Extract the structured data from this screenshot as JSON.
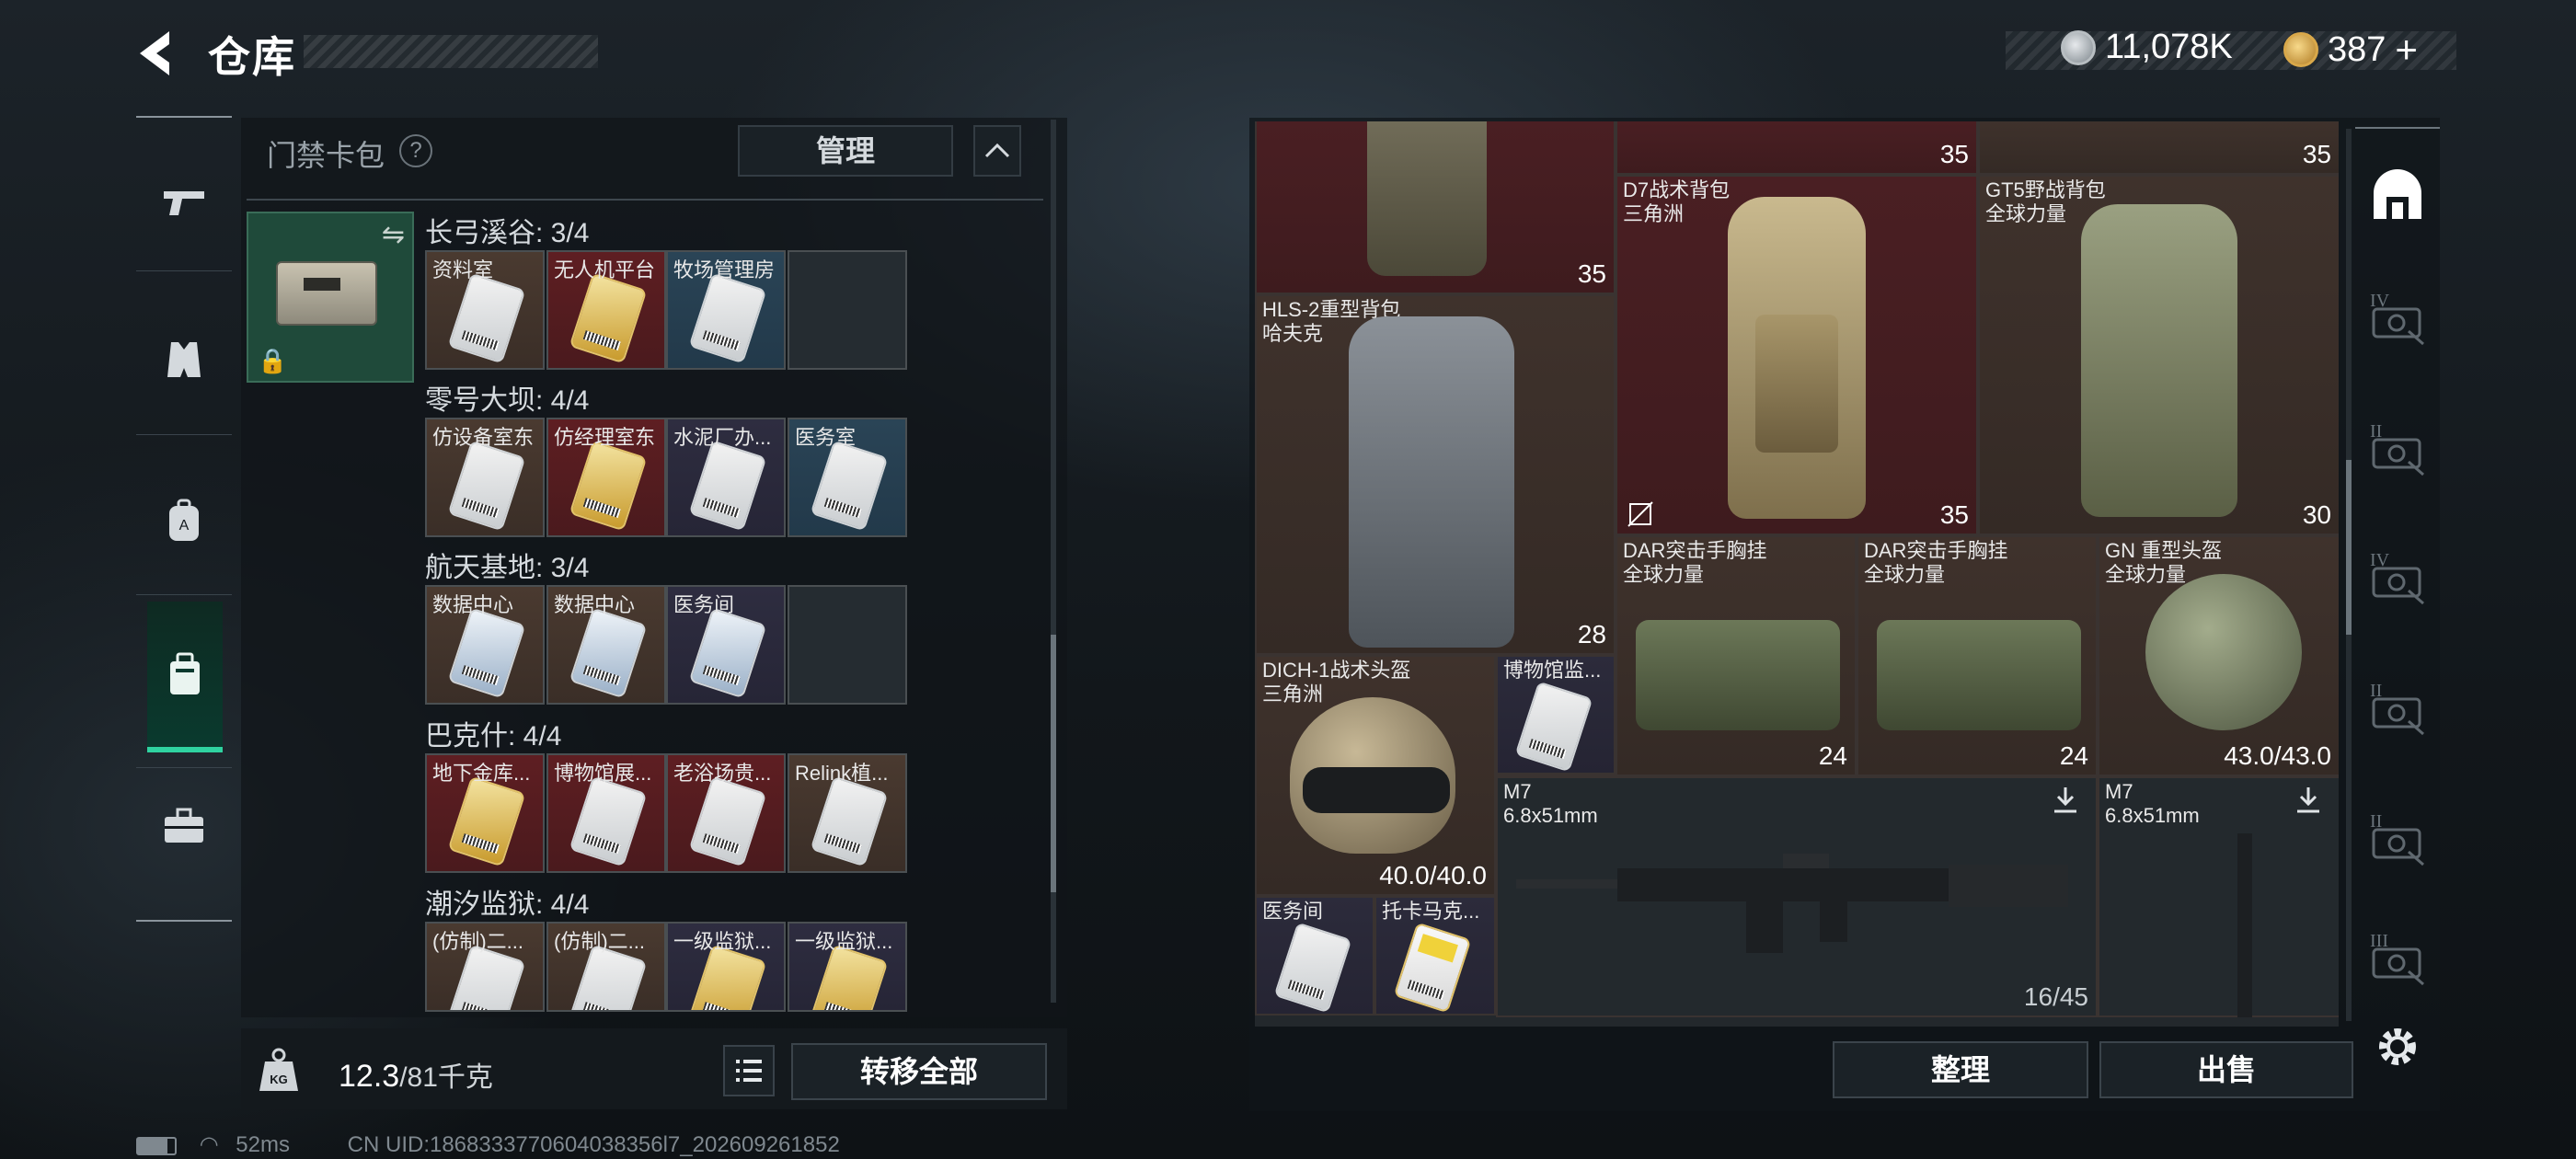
{
  "header": {
    "title": "仓库"
  },
  "currency": [
    {
      "icon": "silver-coin-icon",
      "value": "11,078K"
    },
    {
      "icon": "gold-coin-icon",
      "value": "387"
    },
    {
      "icon": "plus-icon",
      "value": "+"
    }
  ],
  "sidebar": {
    "items": [
      {
        "icon": "gun-icon"
      },
      {
        "icon": "vest-icon"
      },
      {
        "icon": "backpack-icon"
      },
      {
        "icon": "keycard-pack-icon",
        "active": true
      },
      {
        "icon": "toolbox-icon"
      }
    ]
  },
  "keycard_pack": {
    "header_label": "门禁卡包",
    "help": "?",
    "manage_label": "管理",
    "collapse_icon": "chevron-up-icon",
    "sections": [
      {
        "title": "长弓溪谷: 3/4",
        "cards": [
          {
            "label": "资料室",
            "color": "brn",
            "card": "white"
          },
          {
            "label": "无人机平台",
            "color": "red",
            "card": "gold"
          },
          {
            "label": "牧场管理房",
            "color": "blu",
            "card": "white"
          },
          {
            "label": "",
            "color": "emp",
            "card": ""
          }
        ]
      },
      {
        "title": "零号大坝: 4/4",
        "cards": [
          {
            "label": "仿设备室东",
            "color": "brn",
            "card": "white"
          },
          {
            "label": "仿经理室东",
            "color": "red",
            "card": "gold"
          },
          {
            "label": "水泥厂办...",
            "color": "prp",
            "card": "white"
          },
          {
            "label": "医务室",
            "color": "blu",
            "card": "white"
          }
        ]
      },
      {
        "title": "航天基地: 3/4",
        "cards": [
          {
            "label": "数据中心",
            "color": "brn",
            "card": "blue"
          },
          {
            "label": "数据中心",
            "color": "brn",
            "card": "blue"
          },
          {
            "label": "医务间",
            "color": "prp",
            "card": "blue"
          },
          {
            "label": "",
            "color": "emp",
            "card": ""
          }
        ]
      },
      {
        "title": "巴克什: 4/4",
        "cards": [
          {
            "label": "地下金库...",
            "color": "red",
            "card": "gold"
          },
          {
            "label": "博物馆展...",
            "color": "red",
            "card": "white"
          },
          {
            "label": "老浴场贵...",
            "color": "red",
            "card": "white"
          },
          {
            "label": "Relink植...",
            "color": "brn",
            "card": "white"
          }
        ]
      },
      {
        "title": "潮汐监狱: 4/4",
        "cards": [
          {
            "label": "(仿制)二...",
            "color": "brn",
            "card": "white"
          },
          {
            "label": "(仿制)二...",
            "color": "brn",
            "card": "white"
          },
          {
            "label": "一级监狱...",
            "color": "prp",
            "card": "gold"
          },
          {
            "label": "一级监狱...",
            "color": "prp",
            "card": "gold"
          }
        ]
      }
    ]
  },
  "capacity": {
    "current": "12.3",
    "max": "/81千克"
  },
  "buttons": {
    "transfer_all": "转移全部",
    "sort": "整理",
    "sell": "出售"
  },
  "stash_items": [
    {
      "name": "",
      "sub": "",
      "value": "35"
    },
    {
      "name": "",
      "sub": "",
      "value": "35"
    },
    {
      "name": "",
      "sub": "",
      "value": "35"
    },
    {
      "name": "D7战术背包",
      "sub": "三角洲",
      "value": "35"
    },
    {
      "name": "GT5野战背包",
      "sub": "全球力量",
      "value": "30"
    },
    {
      "name": "HLS-2重型背包",
      "sub": "哈夫克",
      "value": "28"
    },
    {
      "name": "DAR突击手胸挂",
      "sub": "全球力量",
      "value": "24"
    },
    {
      "name": "DAR突击手胸挂",
      "sub": "全球力量",
      "value": "24"
    },
    {
      "name": "GN 重型头盔",
      "sub": "全球力量",
      "value": "43.0/43.0"
    },
    {
      "name": "DICH-1战术头盔",
      "sub": "三角洲",
      "value": "40.0/40.0"
    },
    {
      "name": "博物馆监...",
      "sub": "",
      "value": ""
    },
    {
      "name": "M7",
      "sub": "6.8x51mm",
      "value": "16/45"
    },
    {
      "name": "M7",
      "sub": "6.8x51mm",
      "value": ""
    },
    {
      "name": "医务间",
      "sub": "",
      "value": ""
    },
    {
      "name": "托卡马克...",
      "sub": "",
      "value": ""
    }
  ],
  "right_rail": [
    "dome-icon",
    "IV",
    "II",
    "IV",
    "II",
    "II",
    "III"
  ],
  "status": {
    "ping": "52ms",
    "uid": "CN UID:1868333770604038356l7_202609261852"
  }
}
